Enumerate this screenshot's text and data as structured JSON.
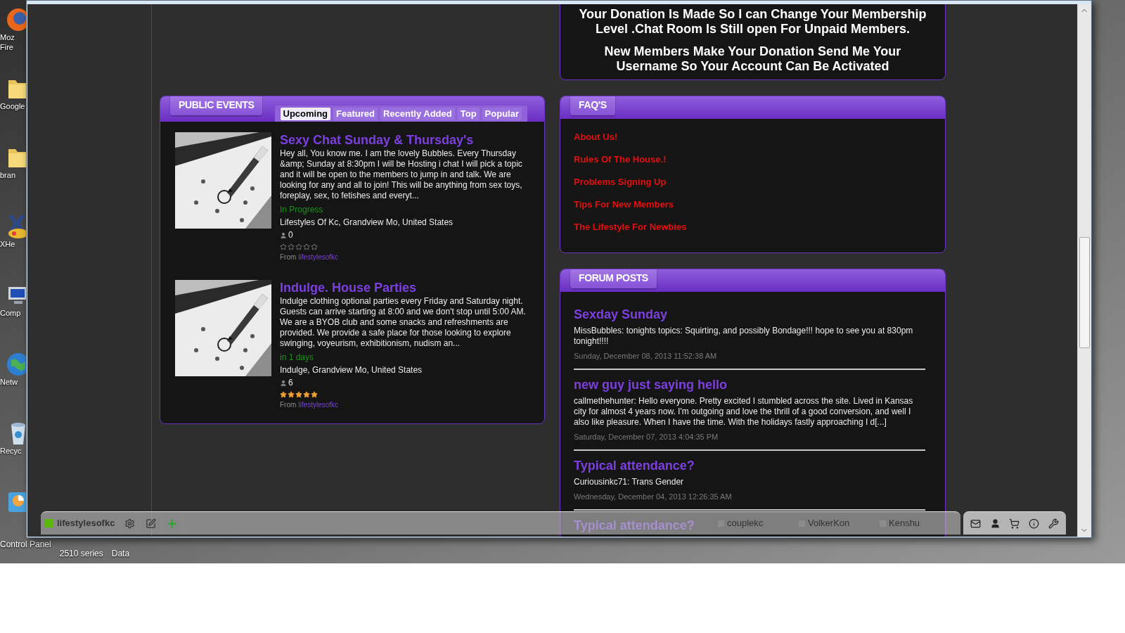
{
  "desktop": {
    "icons": [
      {
        "kind": "firefox",
        "lines": [
          "Moz",
          "Fire"
        ]
      },
      {
        "kind": "folder",
        "lines": [
          "Google"
        ]
      },
      {
        "kind": "folder",
        "lines": [
          "bran"
        ]
      },
      {
        "kind": "xhead",
        "lines": [
          "XHe"
        ]
      },
      {
        "kind": "computer",
        "lines": [
          "Comp"
        ]
      },
      {
        "kind": "network",
        "lines": [
          "Netw"
        ]
      },
      {
        "kind": "recycle",
        "lines": [
          "Recyc"
        ]
      },
      {
        "kind": "control"
      }
    ],
    "bottom_labels": [
      "Control Panel",
      "2510 series",
      "Data"
    ]
  },
  "donation": {
    "paragraphs": [
      "Your Donation Is Made So I can Change Your Membership Level .Chat Room Is Still open For Unpaid Members.",
      "New Members Make Your Donation Send Me Your Username So Your Account Can Be Activated"
    ]
  },
  "public_events": {
    "title": "PUBLIC EVENTS",
    "tabs": [
      {
        "label": "Upcoming",
        "selected": true
      },
      {
        "label": "Featured",
        "selected": false
      },
      {
        "label": "Recently Added",
        "selected": false
      },
      {
        "label": "Top",
        "selected": false
      },
      {
        "label": "Popular",
        "selected": false
      }
    ],
    "events": [
      {
        "title": "Sexy Chat Sunday & Thursday's",
        "description": "Hey all, You know me. I am the lovely Bubbles. Every Thursday &amp; Sunday at 8:30pm I will be Hosting i chat I will pick a topic and it will be open to the members to jump in and talk. We are looking for any and all to join! This will be anything from sex toys, foreplay, sex, to fetishes and everyt...",
        "status": "In Progress",
        "location": "Lifestyles Of Kc, Grandview Mo, United States",
        "attendees": "0",
        "stars": 0,
        "from_label": "From",
        "from_user": "lifestylesofkc"
      },
      {
        "title": "Indulge. House Parties",
        "description": "Indulge clothing optional parties every Friday and Saturday night. Guests can arrive starting at 8:00 and we don't stop until 5:00 AM. We are a BYOB club and some snacks and refreshments are provided. We provide a safe place for those looking to explore swinging, voyeurism, exhibitionism, nudism an...",
        "status": "in 1 days",
        "location": "Indulge, Grandview Mo, United States",
        "attendees": "6",
        "stars": 5,
        "from_label": "From",
        "from_user": "lifestylesofkc"
      }
    ]
  },
  "faqs": {
    "title": "FAQ'S",
    "links": [
      "About Us!",
      "Rules Of The House.!",
      "Problems Signing Up",
      "Tips For New Members",
      "The Lifestyle For Newbies"
    ]
  },
  "forum_posts": {
    "title": "FORUM POSTS",
    "posts": [
      {
        "title": "Sexday Sunday",
        "body": "MissBubbles: tonights topics: Squirting, and possibly Bondage!!! hope to see you at 830pm tonight!!!!",
        "date": "Sunday, December 08, 2013 11:52:38 AM"
      },
      {
        "title": "new guy just saying hello",
        "body": "callmethehunter: Hello everyone. Pretty excited I stumbled across the site. Lived in Kansas city for almost 4 years now. I'm outgoing and love the thrill of a good conversion, and well I also like pleasure. When I have the time. With the holidays fastly approaching I d[...]",
        "date": "Saturday, December 07, 2013 4:04:35 PM"
      },
      {
        "title": "Typical attendance?",
        "body": "Curiousinkc71: Trans Gender",
        "date": "Wednesday, December 04, 2013 12:26:35 AM"
      },
      {
        "title": "Typical attendance?"
      }
    ]
  },
  "toolbar": {
    "user": "lifestylesofkc",
    "online_users": [
      "couplekc",
      "VolkerKon",
      "Kenshu"
    ]
  }
}
